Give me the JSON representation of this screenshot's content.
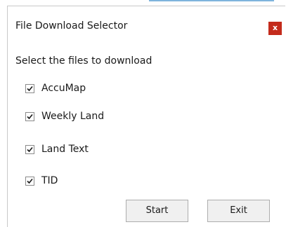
{
  "window": {
    "title": "File Download Selector",
    "close_label": "x"
  },
  "instruction": "Select the files to download",
  "files": [
    {
      "label": "AccuMap",
      "checked": true
    },
    {
      "label": "Weekly Land",
      "checked": true
    },
    {
      "label": "Land Text",
      "checked": true
    },
    {
      "label": "TID",
      "checked": true
    }
  ],
  "buttons": {
    "start_label": "Start",
    "exit_label": "Exit"
  },
  "colors": {
    "close_button": "#c42b1c",
    "button_face": "#f0f0f0",
    "accent_line": "#7fb4dd"
  },
  "icons": {
    "close": "close-icon",
    "checkmark": "checkmark-icon"
  }
}
